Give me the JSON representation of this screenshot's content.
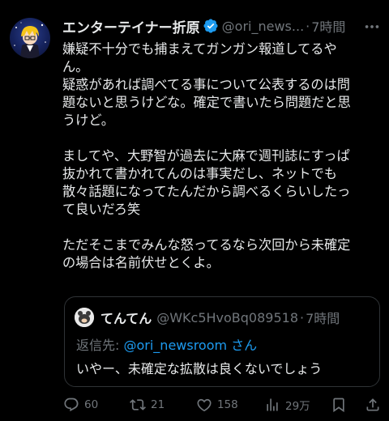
{
  "tweet": {
    "author_name": "エンターテイナー折原",
    "author_handle": "@ori_news...",
    "separator": "·",
    "time": "7時間",
    "lines": [
      "嫌疑不十分でも捕まえてガンガン報道してるや",
      "ん。",
      "疑惑があれば調べてる事について公表するのは問",
      "題ないと思うけどな。確定で書いたら問題だと思",
      "うけど。",
      "",
      "ましてや、大野智が過去に大麻で週刊誌にすっぱ",
      "抜かれて書かれてんのは事実だし、ネットでも",
      "散々話題になってたんだから調べるくらいしたっ",
      "て良いだろ笑",
      "",
      "ただそこまでみんな怒ってるなら次回から未確定",
      "の場合は名前伏せとくよ。"
    ]
  },
  "quote": {
    "author_name": "てんてん",
    "author_handle": "@WKc5HvoBq089518",
    "separator": "·",
    "time": "7時間",
    "reply_prefix": "返信先: ",
    "reply_to": "@ori_newsroom",
    "reply_suffix": " さん",
    "text": "いやー、未確定な拡散は良くないでしょう"
  },
  "actions": {
    "replies": "60",
    "retweets": "21",
    "likes": "158",
    "views": "29万"
  },
  "colors": {
    "background": "#000000",
    "text": "#e7e9ea",
    "muted": "#71767b",
    "link": "#1d9bf0",
    "border": "#2f3336"
  },
  "icons": [
    "verified-badge-icon",
    "more-icon",
    "reply-icon",
    "retweet-icon",
    "like-icon",
    "views-icon",
    "bookmark-icon",
    "share-icon"
  ]
}
